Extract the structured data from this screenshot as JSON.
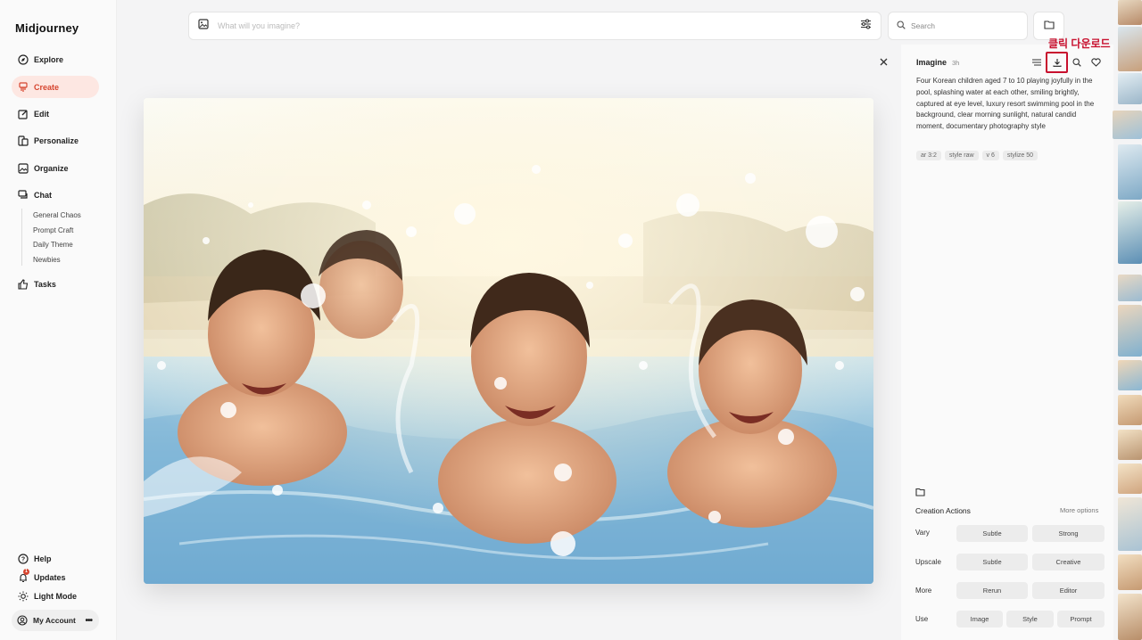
{
  "app": {
    "logo": "Midjourney"
  },
  "nav": {
    "explore": "Explore",
    "create": "Create",
    "edit": "Edit",
    "personalize": "Personalize",
    "organize": "Organize",
    "chat": "Chat",
    "chat_rooms": [
      "General Chaos",
      "Prompt Craft",
      "Daily Theme",
      "Newbies"
    ],
    "tasks": "Tasks",
    "help": "Help",
    "updates": "Updates",
    "updates_badge": "1",
    "light_mode": "Light Mode",
    "account": "My Account"
  },
  "topbar": {
    "prompt_placeholder": "What will you imagine?",
    "search_placeholder": "Search"
  },
  "detail": {
    "title": "Imagine",
    "time": "3h",
    "prompt": "Four Korean children aged 7 to 10 playing joyfully in the pool, splashing water at each other, smiling brightly, captured at eye level, luxury resort swimming pool in the background, clear morning sunlight, natural candid moment, documentary photography style",
    "tags": [
      "ar 3:2",
      "style raw",
      "v 6",
      "stylize 50"
    ],
    "annotation": "클릭 다운로드"
  },
  "actions": {
    "title": "Creation Actions",
    "more_options": "More options",
    "vary": {
      "label": "Vary",
      "buttons": [
        "Subtle",
        "Strong"
      ]
    },
    "upscale": {
      "label": "Upscale",
      "buttons": [
        "Subtle",
        "Creative"
      ]
    },
    "more": {
      "label": "More",
      "buttons": [
        "Rerun",
        "Editor"
      ]
    },
    "use": {
      "label": "Use",
      "buttons": [
        "Image",
        "Style",
        "Prompt"
      ]
    }
  },
  "colors": {
    "accent": "#d6452f",
    "active_bg": "#fde7e2",
    "annotation": "#c8102e"
  }
}
